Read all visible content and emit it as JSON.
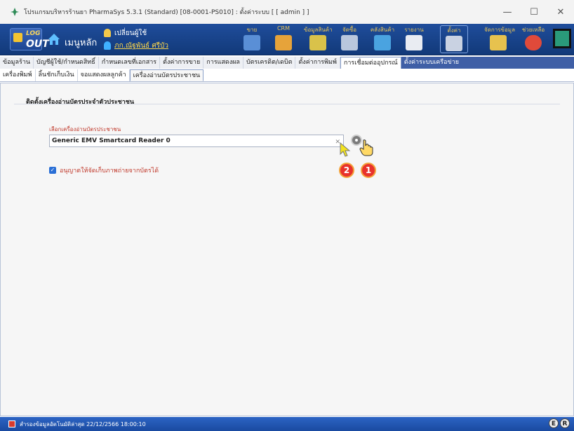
{
  "window": {
    "title": "โปรแกรมบริหารร้านยา PharmaSys 5.3.1 (Standard) [08-0001-PS010] : ตั้งค่าระบบ  [ [ admin ] ]",
    "min": "—",
    "max": "☐",
    "close": "✕"
  },
  "toolbar": {
    "logout_top": "LOG",
    "logout_bottom": "OUT",
    "home_label": "เมนูหลัก",
    "switch_user": "เปลี่ยนผู้ใช้",
    "current_user": "ภก.ณัฐพันธ์ ศรีบัว",
    "buttons": [
      {
        "label": "ขาย",
        "color": "#5a8fd6"
      },
      {
        "label": "CRM",
        "color": "#e6a33a"
      },
      {
        "label": "ข้อมูลสินค้า",
        "color": "#d9c24a"
      },
      {
        "label": "จัดซื้อ",
        "color": "#b9c7dd"
      },
      {
        "label": "คลังสินค้า",
        "color": "#4aa3e0"
      },
      {
        "label": "รายงาน",
        "color": "#e9ecf2"
      },
      {
        "label": "ตั้งค่า",
        "color": "#c9d2e2"
      },
      {
        "label": "จัดการข้อมูล",
        "color": "#e7c24e"
      },
      {
        "label": "ช่วยเหลือ",
        "color": "#e04a3a"
      }
    ]
  },
  "tabs_row1": [
    "ข้อมูลร้าน",
    "บัญชีผู้ใช้/กำหนดสิทธิ์",
    "กำหนดเลขที่เอกสาร",
    "ตั้งค่าการขาย",
    "การแสดงผล",
    "บัตรเครดิต/เดบิต",
    "ตั้งค่าการพิมพ์",
    "การเชื่อมต่ออุปกรณ์",
    "ตั้งค่าระบบเครือข่าย"
  ],
  "tabs_row2": [
    "เครื่องพิมพ์",
    "ลิ้นชักเก็บเงิน",
    "จอแสดงผลลูกค้า",
    "เครื่องอ่านบัตรประชาชน"
  ],
  "section": {
    "title": "ติดตั้งเครื่องอ่านบัตรประจำตัวประชาชน",
    "reader_label": "เลือกเครื่องอ่านบัตรประชาชน",
    "reader_value": "Generic EMV Smartcard Reader 0",
    "dropdown_glyph": "✕",
    "checkbox_label": "อนุญาตให้จัดเก็บภาพถ่ายจากบัตรได้",
    "checkbox_checked": true
  },
  "annotations": {
    "badge1": "1",
    "badge2": "2"
  },
  "status": {
    "text": "สำรองข้อมูลอัตโนมัติล่าสุด  22/12/2566 18:00:10",
    "e": "E",
    "r": "R"
  }
}
